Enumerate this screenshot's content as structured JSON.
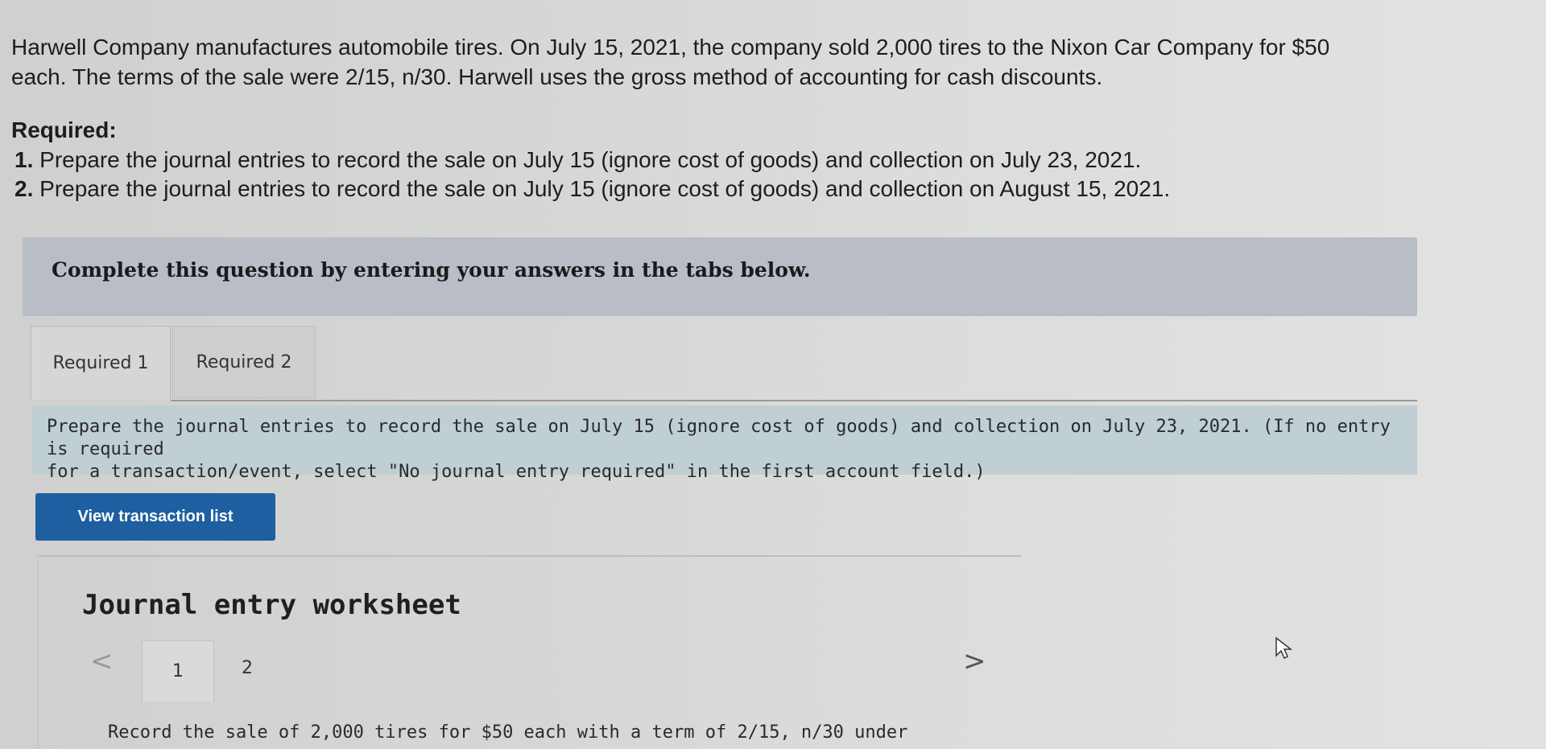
{
  "problem": {
    "line1": "Harwell Company manufactures automobile tires. On July 15, 2021, the company sold 2,000 tires to the Nixon Car Company for $50",
    "line2": "each. The terms of the sale were 2/15, n/30. Harwell uses the gross method of accounting for cash discounts."
  },
  "required": {
    "heading": "Required:",
    "items": [
      {
        "num": "1.",
        "text": " Prepare the journal entries to record the sale on July 15 (ignore cost of goods) and collection on July 23, 2021."
      },
      {
        "num": "2.",
        "text": " Prepare the journal entries to record the sale on July 15 (ignore cost of goods) and collection on August 15, 2021."
      }
    ]
  },
  "banner": {
    "text": "Complete this question by entering your answers in the tabs below."
  },
  "tabs": [
    {
      "label": "Required 1",
      "active": true
    },
    {
      "label": "Required 2",
      "active": false
    }
  ],
  "instructions": {
    "line1": "Prepare the journal entries to record the sale on July 15 (ignore cost of goods) and collection on July 23, 2021. (If no entry is required",
    "line2": "for a transaction/event, select \"No journal entry required\" in the first account field.)"
  },
  "view_button": {
    "label": "View transaction list"
  },
  "worksheet": {
    "title": "Journal entry worksheet",
    "prev_icon": "<",
    "next_icon": ">",
    "pages": [
      "1",
      "2"
    ],
    "record_text": "Record the sale of 2,000 tires for $50 each with a term of 2/15, n/30 under"
  },
  "colors": {
    "button_bg": "#1d5fa0",
    "banner_bg": "#b9bdc6",
    "instructions_bg": "#bfcfd3"
  }
}
